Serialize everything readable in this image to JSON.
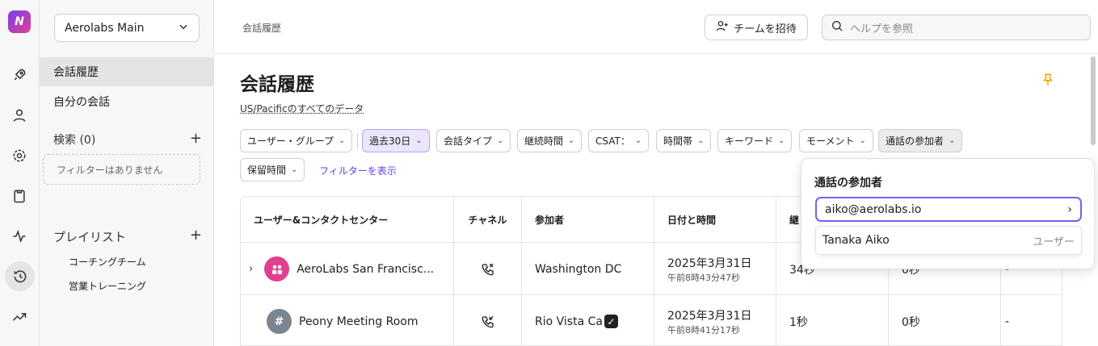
{
  "app": {
    "logo": "N"
  },
  "rail": {
    "icons": [
      "rocket-icon",
      "user-icon",
      "gear-icon",
      "clipboard-icon",
      "activity-icon",
      "history-icon",
      "trending-icon"
    ]
  },
  "sidebar": {
    "workspace": "Aerolabs Main",
    "items": [
      {
        "label": "会話履歴"
      },
      {
        "label": "自分の会話"
      }
    ],
    "search_label": "検索 (0)",
    "no_filters": "フィルターはありません",
    "playlists_label": "プレイリスト",
    "playlists": [
      {
        "label": "コーチングチーム"
      },
      {
        "label": "営業トレーニング"
      }
    ]
  },
  "topbar": {
    "breadcrumb": "会話履歴",
    "invite": "チームを招待",
    "search_placeholder": "ヘルプを参照"
  },
  "page": {
    "title": "会話履歴",
    "timezone": "US/Pacificのすべてのデータ",
    "show_filters": "フィルターを表示"
  },
  "filters": [
    "ユーザー・グループ",
    "過去30日",
    "会話タイプ",
    "継続時間",
    "CSAT：",
    "時間帯",
    "キーワード",
    "モーメント",
    "通話の参加者",
    "保留時間"
  ],
  "table": {
    "headers": [
      "ユーザー&コンタクトセンター",
      "チャネル",
      "参加者",
      "日付と時間",
      "継"
    ],
    "rows": [
      {
        "name": "AeroLabs San Francisc...",
        "participant": "Washington DC",
        "date": "2025年3月31日",
        "time": "午前8時43分47秒",
        "duration": "34秒",
        "hold": "0秒",
        "extra": "-"
      },
      {
        "name": "Peony Meeting Room",
        "avatar_text": "#",
        "participant": "Rio Vista Ca",
        "date": "2025年3月31日",
        "time": "午前8時41分17秒",
        "duration": "1秒",
        "hold": "0秒",
        "extra": "-"
      }
    ]
  },
  "popover": {
    "title": "通話の参加者",
    "input_value": "aiko@aerolabs.io",
    "result_name": "Tanaka Aiko",
    "result_type": "ユーザー"
  },
  "colors": {
    "accent": "#6a3cf0",
    "pin": "#f0a500"
  }
}
